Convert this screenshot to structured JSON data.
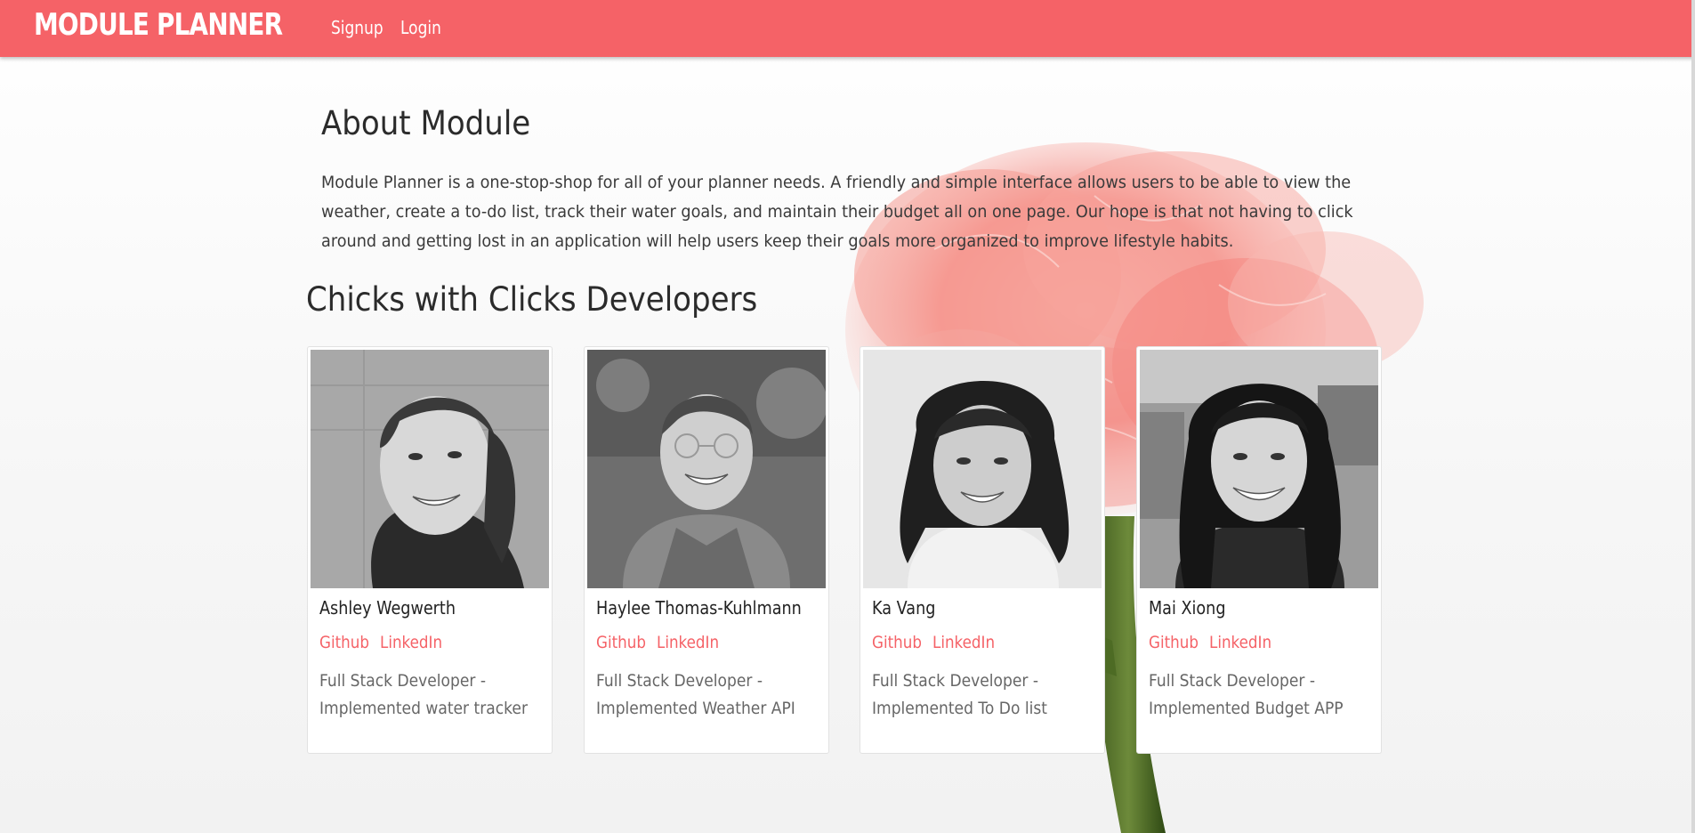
{
  "navbar": {
    "brand": "MODULE PLANNER",
    "links": [
      {
        "label": "Signup"
      },
      {
        "label": "Login"
      }
    ],
    "color": "#f56267"
  },
  "about": {
    "title": "About Module",
    "text": "Module Planner is a one-stop-shop for all of your planner needs. A friendly and simple interface allows users to be able to view the weather, create a to-do list, track their water goals, and maintain their budget all on one page. Our hope is that not having to click around and getting lost in an application will help users keep their goals more organized to improve lifestyle habits."
  },
  "developers": {
    "title": "Chicks with Clicks Developers",
    "cards": [
      {
        "name": "Ashley Wegwerth",
        "github": "Github",
        "linkedin": "LinkedIn",
        "desc_line1": "Full Stack Developer -",
        "desc_line2": "Implemented water tracker"
      },
      {
        "name": "Haylee Thomas-Kuhlmann",
        "github": "Github",
        "linkedin": "LinkedIn",
        "desc_line1": "Full Stack Developer -",
        "desc_line2": "Implemented Weather API"
      },
      {
        "name": "Ka Vang",
        "github": "Github",
        "linkedin": "LinkedIn",
        "desc_line1": "Full Stack Developer -",
        "desc_line2": "Implemented To Do list"
      },
      {
        "name": "Mai Xiong",
        "github": "Github",
        "linkedin": "LinkedIn",
        "desc_line1": "Full Stack Developer -",
        "desc_line2": "Implemented Budget APP"
      }
    ]
  },
  "colors": {
    "accent": "#f56267",
    "background": "#f5f5f5",
    "card": "#ffffff"
  }
}
